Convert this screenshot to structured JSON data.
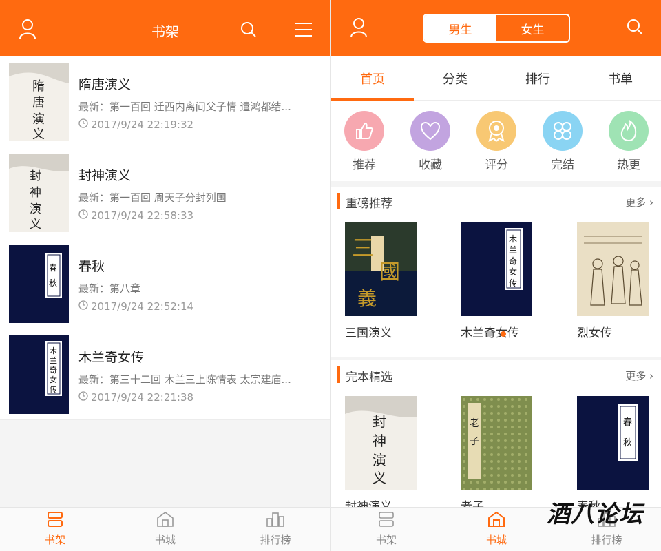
{
  "left": {
    "title": "书架",
    "icons": [
      "user-icon",
      "search-icon",
      "menu-icon"
    ],
    "books": [
      {
        "title": "隋唐演义",
        "latest": "最新：第一百回 迁西内离间父子情 遣鸿都结...",
        "time": "2017/9/24 22:19:32",
        "cover_text": "隋唐演义"
      },
      {
        "title": "封神演义",
        "latest": "最新：第一百回 周天子分封列国",
        "time": "2017/9/24 22:58:33",
        "cover_text": "封神演义"
      },
      {
        "title": "春秋",
        "latest": "最新：第八章",
        "time": "2017/9/24 22:52:14",
        "cover_text": "春秋"
      },
      {
        "title": "木兰奇女传",
        "latest": "最新：第三十二回 木兰三上陈情表 太宗建庙...",
        "time": "2017/9/24 22:21:38",
        "cover_text": "木兰奇女传"
      }
    ],
    "nav": [
      {
        "label": "书架",
        "icon": "shelf-icon",
        "active": true
      },
      {
        "label": "书城",
        "icon": "store-icon",
        "active": false
      },
      {
        "label": "排行榜",
        "icon": "rank-icon",
        "active": false
      }
    ]
  },
  "right": {
    "gender": {
      "male": "男生",
      "female": "女生"
    },
    "tabs": [
      "首页",
      "分类",
      "排行",
      "书单"
    ],
    "categories": [
      {
        "label": "推荐",
        "icon": "thumbs-up-icon",
        "color": "#f7a8b0"
      },
      {
        "label": "收藏",
        "icon": "heart-icon",
        "color": "#c2a4e0"
      },
      {
        "label": "评分",
        "icon": "award-icon",
        "color": "#f8c873"
      },
      {
        "label": "完结",
        "icon": "clover-icon",
        "color": "#8ad4f3"
      },
      {
        "label": "热更",
        "icon": "flame-icon",
        "color": "#9fe3b4"
      }
    ],
    "section1": {
      "title": "重磅推荐",
      "more": "更多",
      "books": [
        {
          "title": "三国演义",
          "cover_text": "三國演義"
        },
        {
          "title": "木兰奇女传",
          "cover_text": "木兰奇女传"
        },
        {
          "title": "烈女传",
          "cover_text": ""
        }
      ]
    },
    "section2": {
      "title": "完本精选",
      "more": "更多",
      "books": [
        {
          "title": "封神演义",
          "cover_text": "封神演义"
        },
        {
          "title": "老子",
          "cover_text": "老子"
        },
        {
          "title": "春秋",
          "cover_text": "春秋"
        }
      ]
    },
    "nav": [
      {
        "label": "书架",
        "icon": "shelf-icon",
        "active": false
      },
      {
        "label": "书城",
        "icon": "store-icon",
        "active": true
      },
      {
        "label": "排行榜",
        "icon": "rank-icon",
        "active": false
      }
    ]
  },
  "watermark": "酒八论坛",
  "colors": {
    "accent": "#ff6a10",
    "navy": "#0b1340"
  }
}
